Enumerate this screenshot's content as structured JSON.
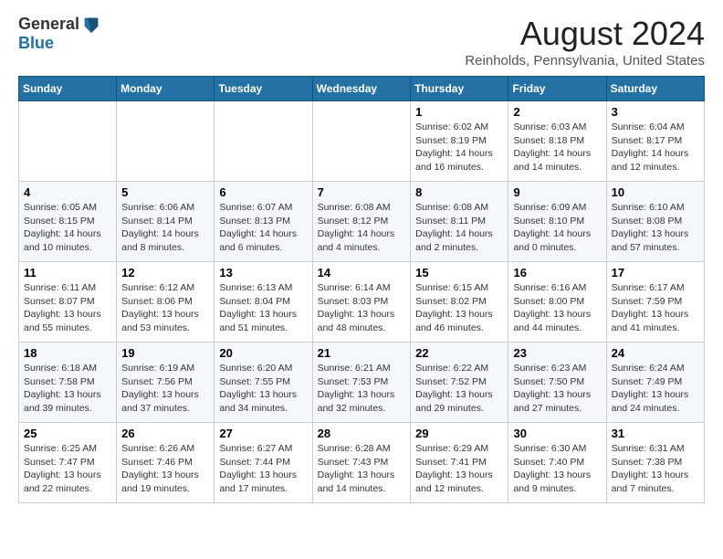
{
  "header": {
    "logo_general": "General",
    "logo_blue": "Blue",
    "month_year": "August 2024",
    "location": "Reinholds, Pennsylvania, United States"
  },
  "calendar": {
    "days_of_week": [
      "Sunday",
      "Monday",
      "Tuesday",
      "Wednesday",
      "Thursday",
      "Friday",
      "Saturday"
    ],
    "weeks": [
      [
        {
          "day": "",
          "info": ""
        },
        {
          "day": "",
          "info": ""
        },
        {
          "day": "",
          "info": ""
        },
        {
          "day": "",
          "info": ""
        },
        {
          "day": "1",
          "info": "Sunrise: 6:02 AM\nSunset: 8:19 PM\nDaylight: 14 hours\nand 16 minutes."
        },
        {
          "day": "2",
          "info": "Sunrise: 6:03 AM\nSunset: 8:18 PM\nDaylight: 14 hours\nand 14 minutes."
        },
        {
          "day": "3",
          "info": "Sunrise: 6:04 AM\nSunset: 8:17 PM\nDaylight: 14 hours\nand 12 minutes."
        }
      ],
      [
        {
          "day": "4",
          "info": "Sunrise: 6:05 AM\nSunset: 8:15 PM\nDaylight: 14 hours\nand 10 minutes."
        },
        {
          "day": "5",
          "info": "Sunrise: 6:06 AM\nSunset: 8:14 PM\nDaylight: 14 hours\nand 8 minutes."
        },
        {
          "day": "6",
          "info": "Sunrise: 6:07 AM\nSunset: 8:13 PM\nDaylight: 14 hours\nand 6 minutes."
        },
        {
          "day": "7",
          "info": "Sunrise: 6:08 AM\nSunset: 8:12 PM\nDaylight: 14 hours\nand 4 minutes."
        },
        {
          "day": "8",
          "info": "Sunrise: 6:08 AM\nSunset: 8:11 PM\nDaylight: 14 hours\nand 2 minutes."
        },
        {
          "day": "9",
          "info": "Sunrise: 6:09 AM\nSunset: 8:10 PM\nDaylight: 14 hours\nand 0 minutes."
        },
        {
          "day": "10",
          "info": "Sunrise: 6:10 AM\nSunset: 8:08 PM\nDaylight: 13 hours\nand 57 minutes."
        }
      ],
      [
        {
          "day": "11",
          "info": "Sunrise: 6:11 AM\nSunset: 8:07 PM\nDaylight: 13 hours\nand 55 minutes."
        },
        {
          "day": "12",
          "info": "Sunrise: 6:12 AM\nSunset: 8:06 PM\nDaylight: 13 hours\nand 53 minutes."
        },
        {
          "day": "13",
          "info": "Sunrise: 6:13 AM\nSunset: 8:04 PM\nDaylight: 13 hours\nand 51 minutes."
        },
        {
          "day": "14",
          "info": "Sunrise: 6:14 AM\nSunset: 8:03 PM\nDaylight: 13 hours\nand 48 minutes."
        },
        {
          "day": "15",
          "info": "Sunrise: 6:15 AM\nSunset: 8:02 PM\nDaylight: 13 hours\nand 46 minutes."
        },
        {
          "day": "16",
          "info": "Sunrise: 6:16 AM\nSunset: 8:00 PM\nDaylight: 13 hours\nand 44 minutes."
        },
        {
          "day": "17",
          "info": "Sunrise: 6:17 AM\nSunset: 7:59 PM\nDaylight: 13 hours\nand 41 minutes."
        }
      ],
      [
        {
          "day": "18",
          "info": "Sunrise: 6:18 AM\nSunset: 7:58 PM\nDaylight: 13 hours\nand 39 minutes."
        },
        {
          "day": "19",
          "info": "Sunrise: 6:19 AM\nSunset: 7:56 PM\nDaylight: 13 hours\nand 37 minutes."
        },
        {
          "day": "20",
          "info": "Sunrise: 6:20 AM\nSunset: 7:55 PM\nDaylight: 13 hours\nand 34 minutes."
        },
        {
          "day": "21",
          "info": "Sunrise: 6:21 AM\nSunset: 7:53 PM\nDaylight: 13 hours\nand 32 minutes."
        },
        {
          "day": "22",
          "info": "Sunrise: 6:22 AM\nSunset: 7:52 PM\nDaylight: 13 hours\nand 29 minutes."
        },
        {
          "day": "23",
          "info": "Sunrise: 6:23 AM\nSunset: 7:50 PM\nDaylight: 13 hours\nand 27 minutes."
        },
        {
          "day": "24",
          "info": "Sunrise: 6:24 AM\nSunset: 7:49 PM\nDaylight: 13 hours\nand 24 minutes."
        }
      ],
      [
        {
          "day": "25",
          "info": "Sunrise: 6:25 AM\nSunset: 7:47 PM\nDaylight: 13 hours\nand 22 minutes."
        },
        {
          "day": "26",
          "info": "Sunrise: 6:26 AM\nSunset: 7:46 PM\nDaylight: 13 hours\nand 19 minutes."
        },
        {
          "day": "27",
          "info": "Sunrise: 6:27 AM\nSunset: 7:44 PM\nDaylight: 13 hours\nand 17 minutes."
        },
        {
          "day": "28",
          "info": "Sunrise: 6:28 AM\nSunset: 7:43 PM\nDaylight: 13 hours\nand 14 minutes."
        },
        {
          "day": "29",
          "info": "Sunrise: 6:29 AM\nSunset: 7:41 PM\nDaylight: 13 hours\nand 12 minutes."
        },
        {
          "day": "30",
          "info": "Sunrise: 6:30 AM\nSunset: 7:40 PM\nDaylight: 13 hours\nand 9 minutes."
        },
        {
          "day": "31",
          "info": "Sunrise: 6:31 AM\nSunset: 7:38 PM\nDaylight: 13 hours\nand 7 minutes."
        }
      ]
    ]
  }
}
